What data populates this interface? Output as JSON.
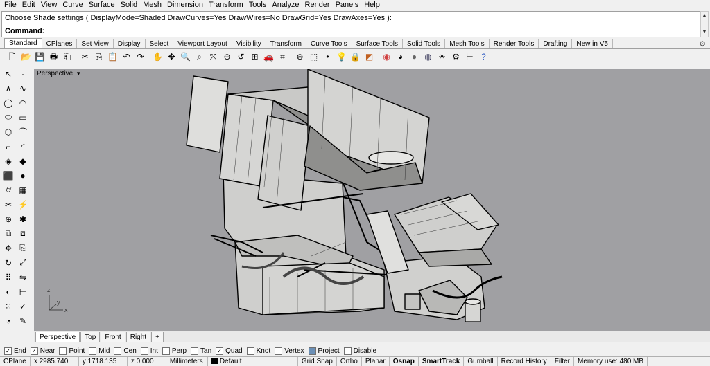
{
  "menu": [
    "File",
    "Edit",
    "View",
    "Curve",
    "Surface",
    "Solid",
    "Mesh",
    "Dimension",
    "Transform",
    "Tools",
    "Analyze",
    "Render",
    "Panels",
    "Help"
  ],
  "command_history": "Choose Shade settings ( DisplayMode=Shaded  DrawCurves=Yes  DrawWires=No  DrawGrid=Yes  DrawAxes=Yes ):",
  "command_prompt": "Command:",
  "toolbar_tabs": [
    "Standard",
    "CPlanes",
    "Set View",
    "Display",
    "Select",
    "Viewport Layout",
    "Visibility",
    "Transform",
    "Curve Tools",
    "Surface Tools",
    "Solid Tools",
    "Mesh Tools",
    "Render Tools",
    "Drafting",
    "New in V5"
  ],
  "toolbar_icons": [
    "new-icon",
    "open-icon",
    "save-icon",
    "print-icon",
    "import-icon",
    "cut-icon",
    "copy-icon",
    "paste-icon",
    "undo-icon",
    "redo-icon",
    "pan-icon",
    "rotate-view-icon",
    "zoom-dynamic-icon",
    "zoom-window-icon",
    "zoom-extents-icon",
    "zoom-selected-icon",
    "undo-view-icon",
    "four-viewports-icon",
    "car-icon",
    "cplane-icon",
    "gumball-icon",
    "select-icon",
    "point-icon",
    "hide-icon",
    "lock-icon",
    "layer-icon",
    "color-wheel-icon",
    "shaded-icon",
    "render-icon",
    "rendered-icon",
    "light-icon",
    "options-icon",
    "dimension-icon",
    "help-icon"
  ],
  "viewport": {
    "title": "Perspective",
    "axes": {
      "z": "z",
      "y": "y",
      "x": "x"
    }
  },
  "viewport_tabs": [
    "Perspective",
    "Top",
    "Front",
    "Right"
  ],
  "viewport_add": "+",
  "osnaps": [
    {
      "label": "End",
      "checked": true
    },
    {
      "label": "Near",
      "checked": true
    },
    {
      "label": "Point",
      "checked": false
    },
    {
      "label": "Mid",
      "checked": false
    },
    {
      "label": "Cen",
      "checked": false
    },
    {
      "label": "Int",
      "checked": false
    },
    {
      "label": "Perp",
      "checked": false
    },
    {
      "label": "Tan",
      "checked": false
    },
    {
      "label": "Quad",
      "checked": true
    },
    {
      "label": "Knot",
      "checked": false
    },
    {
      "label": "Vertex",
      "checked": false
    },
    {
      "label": "Project",
      "checked": false,
      "filled": true
    },
    {
      "label": "Disable",
      "checked": false
    }
  ],
  "status": {
    "cplane": "CPlane",
    "x": "x 2985.740",
    "y": "y 1718.135",
    "z": "z 0.000",
    "units": "Millimeters",
    "layer": "Default",
    "grid_snap": "Grid Snap",
    "ortho": "Ortho",
    "planar": "Planar",
    "osnap": "Osnap",
    "smarttrack": "SmartTrack",
    "gumball": "Gumball",
    "record_history": "Record History",
    "filter": "Filter",
    "memory": "Memory use: 480 MB"
  }
}
